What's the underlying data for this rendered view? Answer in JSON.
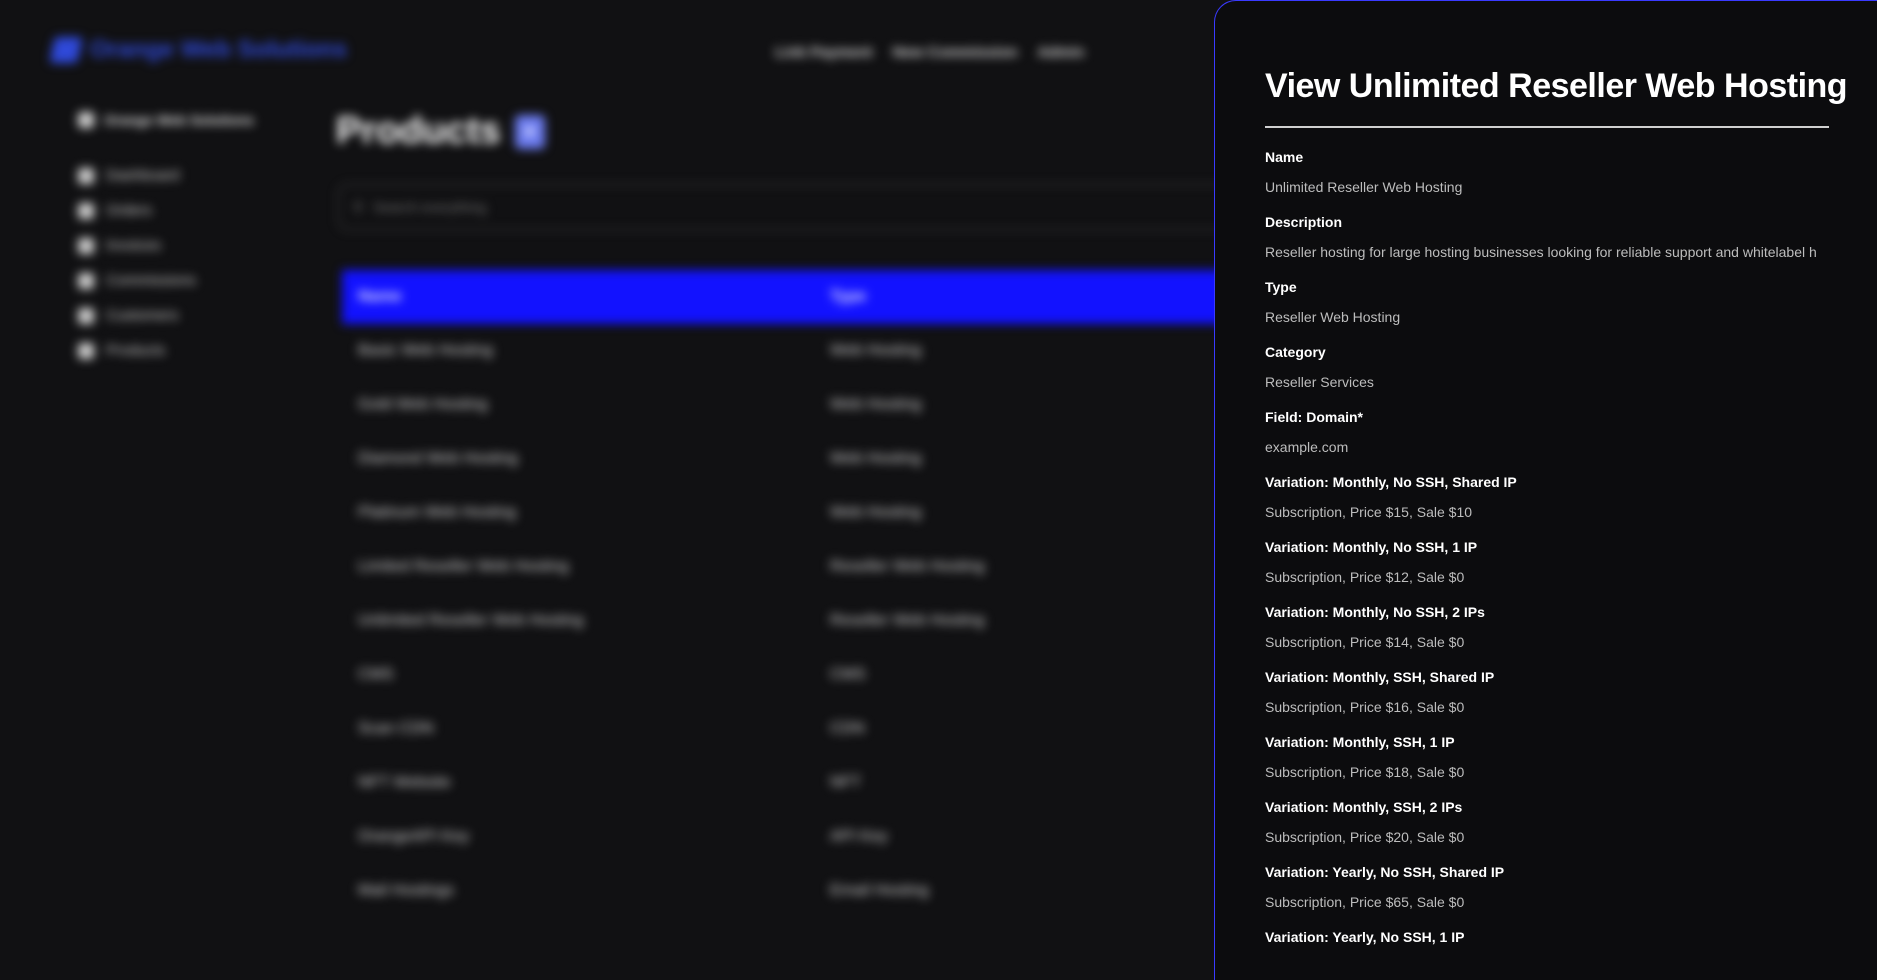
{
  "brand": {
    "name": "Orange Web Solutions",
    "accent": "#2f49d9"
  },
  "topnav": [
    "Link Payment",
    "New Commission",
    "Admin"
  ],
  "sidebar": {
    "org": "Orange Web Solutions",
    "items": [
      {
        "label": "Dashboard",
        "icon": "home-icon"
      },
      {
        "label": "Orders",
        "icon": "orders-icon"
      },
      {
        "label": "Invoices",
        "icon": "invoice-icon"
      },
      {
        "label": "Commissions",
        "icon": "commission-icon"
      },
      {
        "label": "Customers",
        "icon": "customers-icon"
      },
      {
        "label": "Products",
        "icon": "products-icon"
      }
    ]
  },
  "main": {
    "title": "Products",
    "add_label": "+",
    "search_placeholder": "Search everything",
    "columns": [
      "Name",
      "Type"
    ],
    "rows": [
      [
        "Basic Web Hosting",
        "Web Hosting"
      ],
      [
        "Gold Web Hosting",
        "Web Hosting"
      ],
      [
        "Diamond Web Hosting",
        "Web Hosting"
      ],
      [
        "Platinum Web Hosting",
        "Web Hosting"
      ],
      [
        "Limited Reseller Web Hosting",
        "Reseller Web Hosting"
      ],
      [
        "Unlimited Reseller Web Hosting",
        "Reseller Web Hosting"
      ],
      [
        "CMS",
        "CMS"
      ],
      [
        "Scan CDN",
        "CDN"
      ],
      [
        "NFT Website",
        "NFT"
      ],
      [
        "OrangeAPI Key",
        "API Key"
      ],
      [
        "Mail Hostings",
        "Email Hosting"
      ]
    ],
    "header_color": "#1212ff"
  },
  "panel": {
    "title": "View Unlimited Reseller Web Hosting",
    "border_color": "#3a3aff",
    "fields": [
      {
        "label": "Name",
        "value": "Unlimited Reseller Web Hosting"
      },
      {
        "label": "Description",
        "value": "Reseller hosting for large hosting businesses looking for reliable support and whitelabel h"
      },
      {
        "label": "Type",
        "value": "Reseller Web Hosting"
      },
      {
        "label": "Category",
        "value": "Reseller Services"
      },
      {
        "label": "Field: Domain*",
        "value": "example.com"
      },
      {
        "label": "Variation: Monthly, No SSH, Shared IP",
        "value": "Subscription, Price $15, Sale $10"
      },
      {
        "label": "Variation: Monthly, No SSH, 1 IP",
        "value": "Subscription, Price $12, Sale $0"
      },
      {
        "label": "Variation: Monthly, No SSH, 2 IPs",
        "value": "Subscription, Price $14, Sale $0"
      },
      {
        "label": "Variation: Monthly, SSH, Shared IP",
        "value": "Subscription, Price $16, Sale $0"
      },
      {
        "label": "Variation: Monthly, SSH, 1 IP",
        "value": "Subscription, Price $18, Sale $0"
      },
      {
        "label": "Variation: Monthly, SSH, 2 IPs",
        "value": "Subscription, Price $20, Sale $0"
      },
      {
        "label": "Variation: Yearly, No SSH, Shared IP",
        "value": "Subscription, Price $65, Sale $0"
      },
      {
        "label": "Variation: Yearly, No SSH, 1 IP",
        "value": ""
      }
    ]
  }
}
